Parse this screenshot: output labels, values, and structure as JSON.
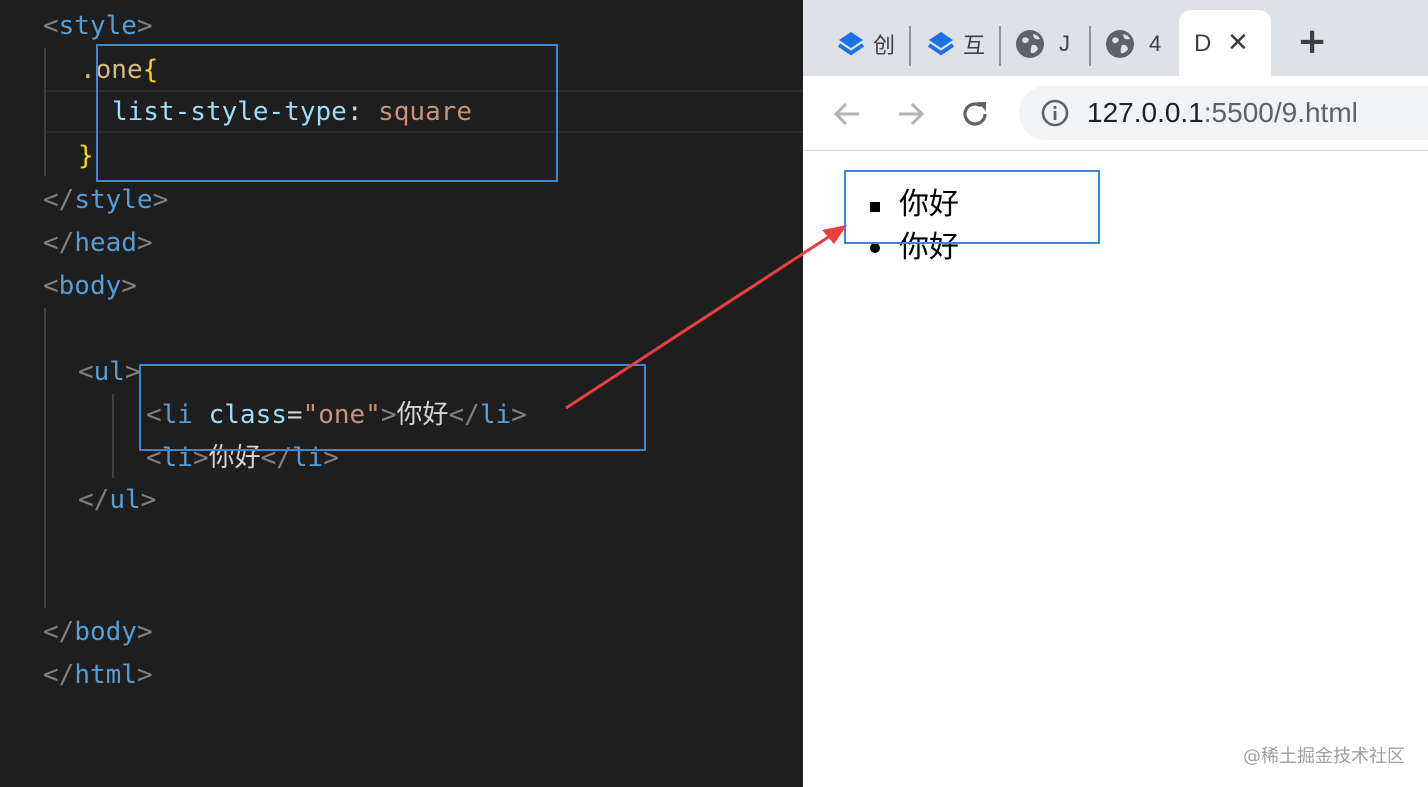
{
  "editor": {
    "lines": {
      "style_open": {
        "open": "<",
        "tag": "style",
        "close": ">"
      },
      "selector": {
        "dot": ".",
        "name": "one",
        "brace": "{"
      },
      "declaration": {
        "property": "list-style-type",
        "colon": ":",
        "value": "square"
      },
      "brace_close": "}",
      "style_close": {
        "open": "</",
        "tag": "style",
        "close": ">"
      },
      "head_close": {
        "open": "</",
        "tag": "head",
        "close": ">"
      },
      "body_open": {
        "open": "<",
        "tag": "body",
        "close": ">"
      },
      "ul_open": {
        "open": "<",
        "tag": "ul",
        "close": ">"
      },
      "li_one": {
        "open": "<",
        "tag": "li",
        "attr": "class",
        "eq": "=",
        "val": "\"one\"",
        "close": ">",
        "text": "你好",
        "end_open": "</",
        "end_tag": "li",
        "end_close": ">"
      },
      "li_two": {
        "open": "<",
        "tag": "li",
        "close": ">",
        "text": "你好",
        "end_open": "</",
        "end_tag": "li",
        "end_close": ">"
      },
      "ul_close": {
        "open": "</",
        "tag": "ul",
        "close": ">"
      },
      "body_close": {
        "open": "</",
        "tag": "body",
        "close": ">"
      },
      "html_close": {
        "open": "</",
        "tag": "html",
        "close": ">"
      }
    }
  },
  "browser": {
    "tabs": [
      {
        "title": "创",
        "icon": "layers-icon"
      },
      {
        "title": "互",
        "icon": "layers-icon"
      },
      {
        "title": "J",
        "icon": "globe-icon"
      },
      {
        "title": "4",
        "icon": "globe-icon"
      }
    ],
    "active_tab": {
      "title": "D",
      "close": "✕"
    },
    "new_tab": "+",
    "address": {
      "host": "127.0.0.1",
      "path": ":5500/9.html"
    },
    "page": {
      "items": [
        "你好",
        "你好"
      ]
    }
  },
  "watermark": "@稀土掘金技术社区",
  "colors": {
    "editor_bg": "#1e1e1e",
    "highlight": "#3b87d6",
    "arrow": "#e8403f",
    "tab_strip": "#dee1e6"
  }
}
